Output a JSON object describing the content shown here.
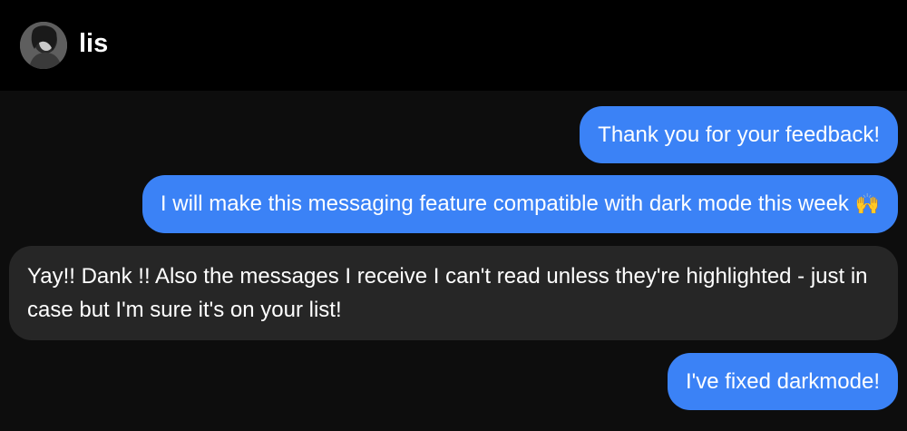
{
  "header": {
    "contact_name": "lis",
    "avatar_icon": "user-avatar-photo"
  },
  "colors": {
    "outgoing_bubble": "#3b82f6",
    "incoming_bubble": "#262626",
    "background": "#0d0d0d",
    "header_background": "#000000"
  },
  "messages": [
    {
      "direction": "outgoing",
      "text": "Thank you for your feedback!"
    },
    {
      "direction": "outgoing",
      "text": "I will make this messaging feature compatible with dark mode this week",
      "emoji": "🙌"
    },
    {
      "direction": "incoming",
      "text": "Yay!! Dank !! Also the messages I receive I can't read unless they're highlighted - just in case but I'm sure it's on your list!"
    },
    {
      "direction": "outgoing",
      "text": "I've fixed darkmode!"
    }
  ]
}
